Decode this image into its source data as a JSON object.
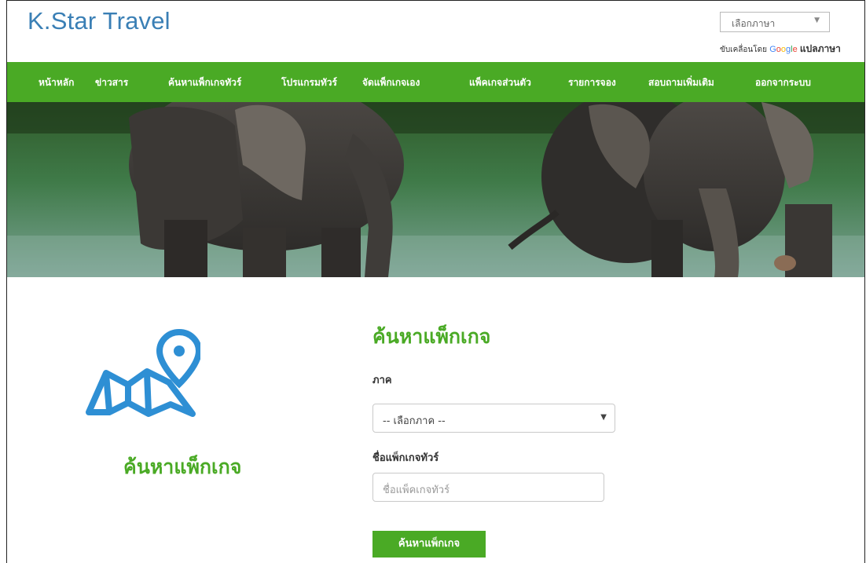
{
  "header": {
    "brand": "K.Star Travel",
    "language_select": {
      "value": "เลือกภาษา"
    },
    "powered_by": {
      "prefix": "ขับเคลื่อนโดย",
      "google": "Google",
      "translate": "แปลภาษา"
    }
  },
  "nav": {
    "items": [
      "หน้าหลัก",
      "ข่าวสาร",
      "ค้นหาแพ็กเกจทัวร์",
      "โปรแกรมทัวร์",
      "จัดแพ็กเกจเอง",
      "แพ็คเกจส่วนตัว",
      "รายการจอง",
      "สอบถามเพิ่มเติม",
      "ออกจากระบบ"
    ]
  },
  "side": {
    "title": "ค้นหาแพ็กเกจ"
  },
  "form": {
    "title": "ค้นหาแพ็กเกจ",
    "region_label": "ภาค",
    "region_select": "-- เลือกภาค --",
    "name_label": "ชื่อแพ็กเกจทัวร์",
    "name_placeholder": "ชื่อแพ็คเกจทัวร์",
    "search_button": "ค้นหาแพ็กเกจ"
  },
  "colors": {
    "brand": "#3a7fb5",
    "nav_bg": "#4aaa25",
    "accent": "#4aaa25",
    "icon": "#2e8fd4"
  }
}
